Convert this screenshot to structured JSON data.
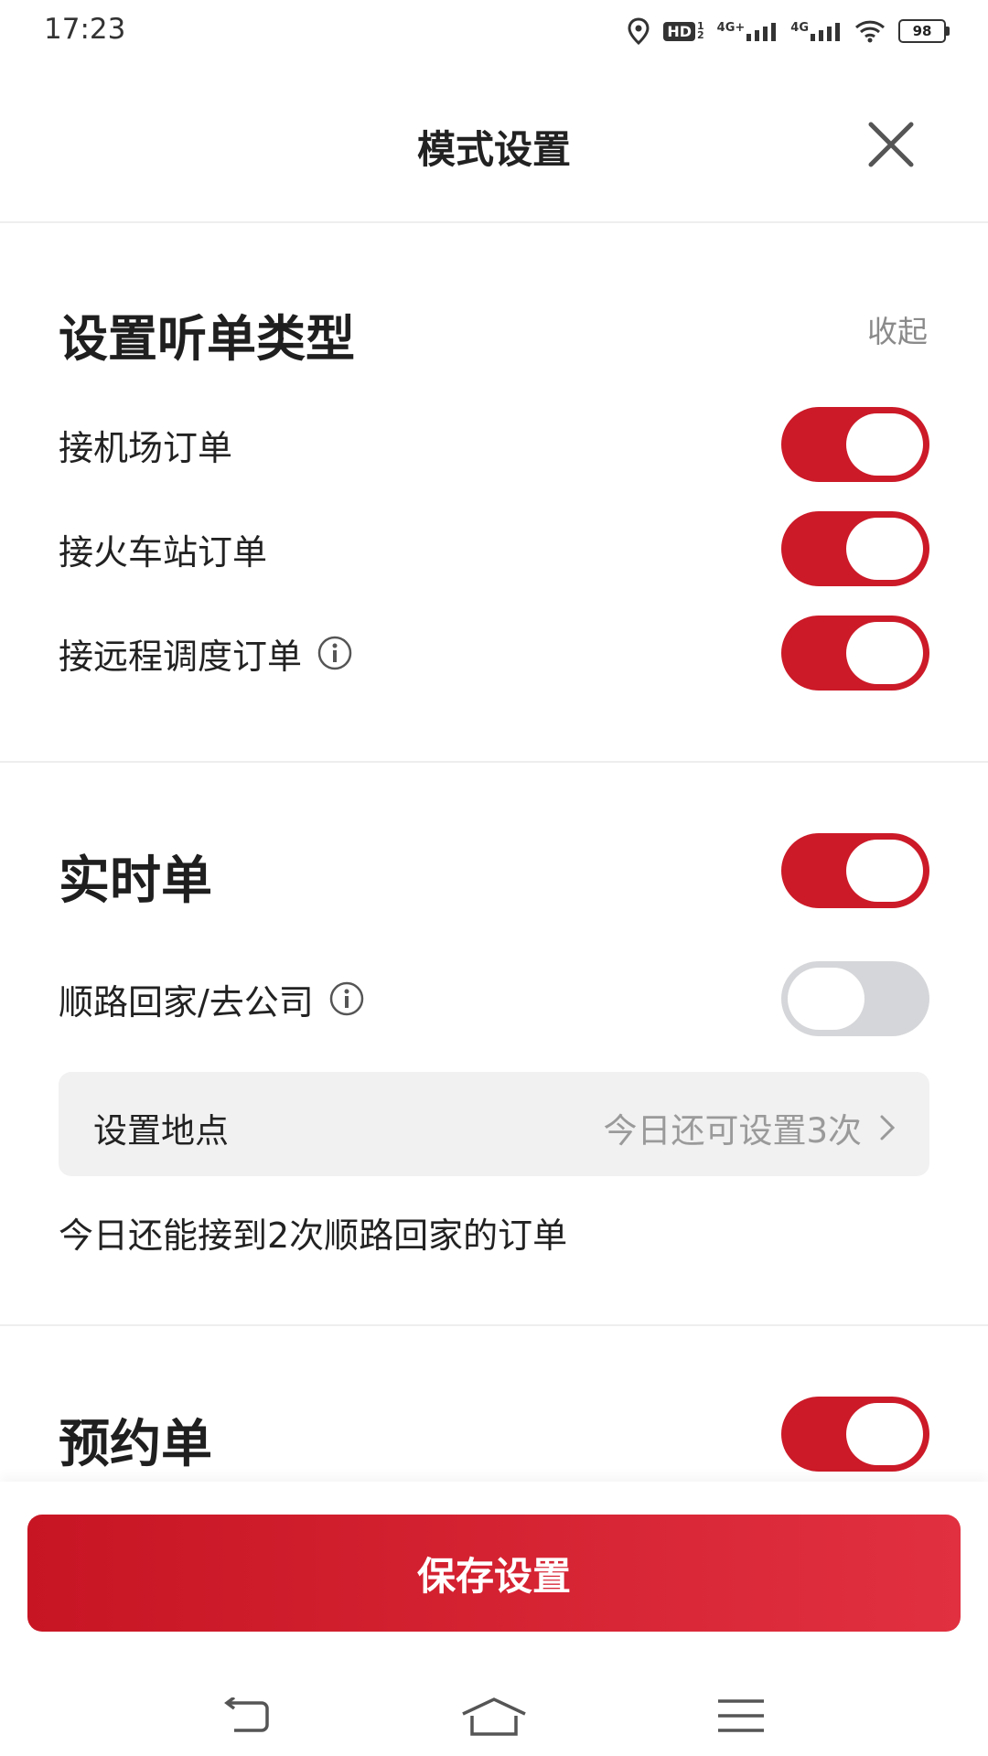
{
  "status_bar": {
    "time": "17:23",
    "hd_label": "HD",
    "hd_sub": "1\n2",
    "net1": "4G+",
    "net2": "4G",
    "battery": "98"
  },
  "header": {
    "title": "模式设置"
  },
  "order_types": {
    "title": "设置听单类型",
    "collapse_label": "收起",
    "items": [
      {
        "label": "接机场订单",
        "enabled": true
      },
      {
        "label": "接火车站订单",
        "enabled": true
      },
      {
        "label": "接远程调度订单",
        "enabled": true
      }
    ]
  },
  "realtime": {
    "title": "实时单",
    "enabled": true,
    "route_home": {
      "label": "顺路回家/去公司",
      "enabled": false
    },
    "set_location": {
      "label": "设置地点",
      "remaining": "今日还可设置3次"
    },
    "note": "今日还能接到2次顺路回家的订单"
  },
  "reservation": {
    "title": "预约单",
    "enabled": true
  },
  "save_button": {
    "label": "保存设置"
  },
  "colors": {
    "accent": "#cc1a28",
    "toggle_off": "#d5d6d9",
    "card_bg": "#f1f1f1"
  },
  "nav_icons": [
    "back-icon",
    "home-icon",
    "menu-icon"
  ]
}
